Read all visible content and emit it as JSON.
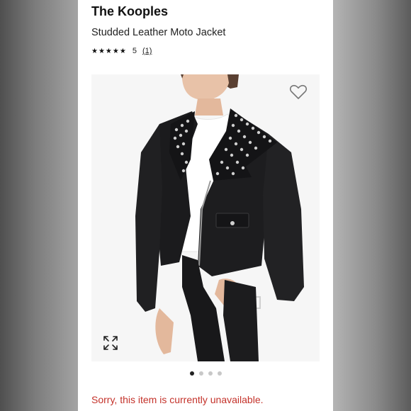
{
  "product": {
    "brand": "The Kooples",
    "name": "Studded Leather Moto Jacket",
    "stars": "★★★★★",
    "rating": "5",
    "review_count": "(1)",
    "rating_value": 5
  },
  "gallery": {
    "image_alt": "jacket",
    "slide_count": 4,
    "active_slide": 1
  },
  "icons": {
    "favorite": "heart-outline-icon",
    "expand": "expand-arrows-icon"
  },
  "status": {
    "message": "Sorry, this item is currently unavailable.",
    "color": "#c4322a"
  }
}
